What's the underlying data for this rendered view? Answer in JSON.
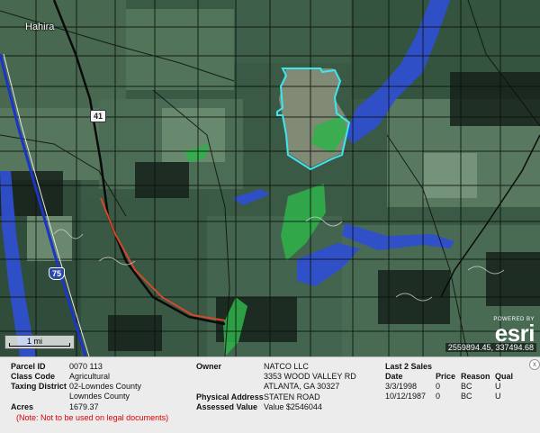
{
  "map": {
    "place_label": "Hahira",
    "route_us": "41",
    "route_interstate": "75",
    "scale_label": "1 mi",
    "powered_by": "POWERED BY",
    "esri_logo": "esri",
    "coordinates": "2559894.45, 337494.68"
  },
  "panel": {
    "labels": {
      "parcel_id": "Parcel ID",
      "class_code": "Class Code",
      "taxing_district": "Taxing District",
      "acres": "Acres",
      "owner": "Owner",
      "physical_address": "Physical Address",
      "assessed_value": "Assessed Value"
    },
    "values": {
      "parcel_id": "0070 113",
      "class_code": "Agricultural",
      "taxing_district_1": "02-Lowndes County",
      "taxing_district_2": "Lowndes County",
      "acres": "1679.37",
      "owner_name": "NATCO LLC",
      "owner_street": "3353 WOOD VALLEY RD",
      "owner_city": "ATLANTA, GA 30327",
      "physical_address": "STATEN ROAD",
      "assessed_value": "Value $2546044"
    },
    "note": "(Note: Not to be used on legal documents)",
    "sales": {
      "title": "Last 2 Sales",
      "headers": [
        "Date",
        "Price",
        "Reason",
        "Qual"
      ],
      "rows": [
        [
          "3/3/1998",
          "0",
          "BC",
          "U"
        ],
        [
          "10/12/1987",
          "0",
          "BC",
          "U"
        ]
      ]
    },
    "close_icon": "x"
  }
}
